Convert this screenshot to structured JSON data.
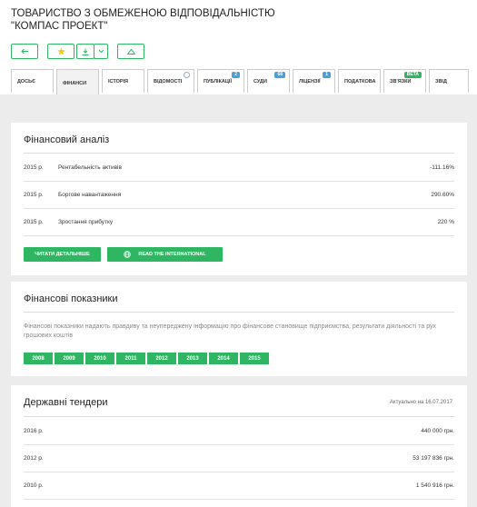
{
  "company": {
    "title": "ТОВАРИСТВО З ОБМЕЖЕНОЮ ВІДПОВІДАЛЬНІСТЮ \"КОМПАС ПРОЕКТ\""
  },
  "colors": {
    "accent": "#2fb663",
    "badge": "#4a9fd8",
    "panel_bg": "#ececec"
  },
  "toolbar": {
    "back_icon": "arrow-left-icon",
    "star_icon": "star-icon",
    "download_icon": "download-icon",
    "dropdown_icon": "chevron-down-icon",
    "up_icon": "triangle-up-icon"
  },
  "tabs": [
    {
      "label": "Досьє"
    },
    {
      "label": "Фінанси",
      "active": true
    },
    {
      "label": "Історія"
    },
    {
      "label": "Відомості"
    },
    {
      "label": "Публікації",
      "badge": "2"
    },
    {
      "label": "Суди",
      "badge": "68"
    },
    {
      "label": "Ліцензії",
      "badge": "1"
    },
    {
      "label": "Податкова"
    },
    {
      "label": "Зв'язки",
      "badge": "beta"
    },
    {
      "label": "Звід"
    }
  ],
  "financial_analysis": {
    "title": "Фінансовий аналіз",
    "rows": [
      {
        "year": "2015 р.",
        "label": "Рентабельність активів",
        "value": "-111.16%"
      },
      {
        "year": "2015 р.",
        "label": "Боргове навантаження",
        "value": "290.60%"
      },
      {
        "year": "2015 р.",
        "label": "Зростання прибутку",
        "value": "220 %"
      }
    ],
    "read_more_label": "Читати детальніше",
    "international_label": "Read the international",
    "globe_icon": "globe-icon"
  },
  "financial_indicators": {
    "title": "Фінансові показники",
    "description": "Фінансові показники надають правдиву та неупереджену інформацію про фінансове становище підприємства, результати діяльності та рух грошових коштів",
    "years": [
      "2008",
      "2009",
      "2010",
      "2011",
      "2012",
      "2013",
      "2014",
      "2015"
    ]
  },
  "tenders": {
    "title": "Державні тендери",
    "actual_note": "Актуально на 16.07.2017",
    "rows": [
      {
        "year": "2016 р.",
        "value": "440 000 грн."
      },
      {
        "year": "2012 р.",
        "value": "53 197 836 грн."
      },
      {
        "year": "2010 р.",
        "value": "1 540 916 грн."
      }
    ]
  }
}
